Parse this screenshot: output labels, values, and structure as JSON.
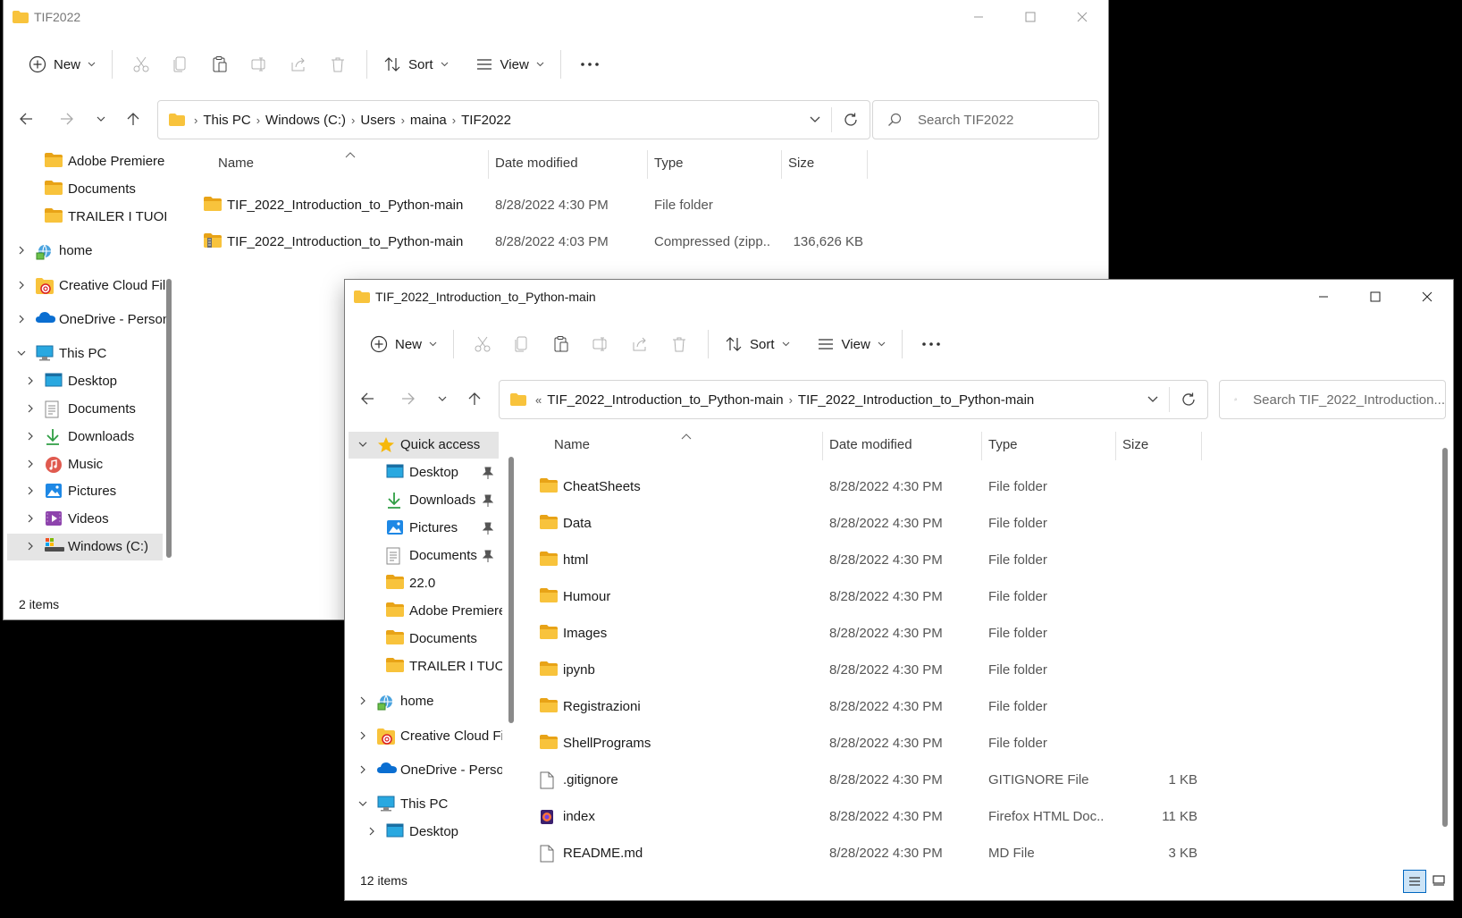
{
  "colors": {
    "folder": "#f8c33c",
    "folder_dark": "#e8a317",
    "accent": "#0067c0"
  },
  "back_window": {
    "title": "TIF2022",
    "toolbar": {
      "new_label": "New",
      "sort_label": "Sort",
      "view_label": "View"
    },
    "breadcrumb": [
      "This PC",
      "Windows (C:)",
      "Users",
      "maina",
      "TIF2022"
    ],
    "search_placeholder": "Search TIF2022",
    "sidebar": [
      {
        "label": "Adobe Premiere",
        "icon": "folder-icon"
      },
      {
        "label": "Documents",
        "icon": "folder-icon"
      },
      {
        "label": "TRAILER I TUOI (",
        "icon": "folder-icon"
      },
      {
        "label": "home",
        "icon": "home-network-icon"
      },
      {
        "label": "Creative Cloud File",
        "icon": "creative-cloud-icon"
      },
      {
        "label": "OneDrive - Person",
        "icon": "onedrive-icon"
      },
      {
        "label": "This PC",
        "icon": "pc-icon"
      },
      {
        "label": "Desktop",
        "icon": "desktop-icon"
      },
      {
        "label": "Documents",
        "icon": "documents-icon"
      },
      {
        "label": "Downloads",
        "icon": "downloads-icon"
      },
      {
        "label": "Music",
        "icon": "music-icon"
      },
      {
        "label": "Pictures",
        "icon": "pictures-icon"
      },
      {
        "label": "Videos",
        "icon": "videos-icon"
      },
      {
        "label": "Windows (C:)",
        "icon": "drive-icon"
      }
    ],
    "columns": [
      "Name",
      "Date modified",
      "Type",
      "Size"
    ],
    "files": [
      {
        "name": "TIF_2022_Introduction_to_Python-main",
        "date": "8/28/2022 4:30 PM",
        "type": "File folder",
        "size": "",
        "icon": "folder-icon"
      },
      {
        "name": "TIF_2022_Introduction_to_Python-main",
        "date": "8/28/2022 4:03 PM",
        "type": "Compressed (zipp...",
        "size": "136,626 KB",
        "icon": "zip-folder-icon"
      }
    ],
    "status": "2 items"
  },
  "front_window": {
    "title": "TIF_2022_Introduction_to_Python-main",
    "toolbar": {
      "new_label": "New",
      "sort_label": "Sort",
      "view_label": "View"
    },
    "breadcrumb_overflow": "«",
    "breadcrumb": [
      "TIF_2022_Introduction_to_Python-main",
      "TIF_2022_Introduction_to_Python-main"
    ],
    "search_placeholder": "Search TIF_2022_Introduction...",
    "sidebar": [
      {
        "label": "Quick access",
        "icon": "star-icon"
      },
      {
        "label": "Desktop",
        "icon": "desktop-icon"
      },
      {
        "label": "Downloads",
        "icon": "downloads-icon"
      },
      {
        "label": "Pictures",
        "icon": "pictures-icon"
      },
      {
        "label": "Documents",
        "icon": "documents-icon"
      },
      {
        "label": "22.0",
        "icon": "folder-icon"
      },
      {
        "label": "Adobe Premiere",
        "icon": "folder-icon"
      },
      {
        "label": "Documents",
        "icon": "folder-icon"
      },
      {
        "label": "TRAILER I TUOI (",
        "icon": "folder-icon"
      },
      {
        "label": "home",
        "icon": "home-network-icon"
      },
      {
        "label": "Creative Cloud File",
        "icon": "creative-cloud-icon"
      },
      {
        "label": "OneDrive - Person",
        "icon": "onedrive-icon"
      },
      {
        "label": "This PC",
        "icon": "pc-icon"
      },
      {
        "label": "Desktop",
        "icon": "desktop-icon"
      }
    ],
    "columns": [
      "Name",
      "Date modified",
      "Type",
      "Size"
    ],
    "files": [
      {
        "name": "CheatSheets",
        "date": "8/28/2022 4:30 PM",
        "type": "File folder",
        "size": "",
        "icon": "folder-icon"
      },
      {
        "name": "Data",
        "date": "8/28/2022 4:30 PM",
        "type": "File folder",
        "size": "",
        "icon": "folder-icon"
      },
      {
        "name": "html",
        "date": "8/28/2022 4:30 PM",
        "type": "File folder",
        "size": "",
        "icon": "folder-icon"
      },
      {
        "name": "Humour",
        "date": "8/28/2022 4:30 PM",
        "type": "File folder",
        "size": "",
        "icon": "folder-icon"
      },
      {
        "name": "Images",
        "date": "8/28/2022 4:30 PM",
        "type": "File folder",
        "size": "",
        "icon": "folder-icon"
      },
      {
        "name": "ipynb",
        "date": "8/28/2022 4:30 PM",
        "type": "File folder",
        "size": "",
        "icon": "folder-icon"
      },
      {
        "name": "Registrazioni",
        "date": "8/28/2022 4:30 PM",
        "type": "File folder",
        "size": "",
        "icon": "folder-icon"
      },
      {
        "name": "ShellPrograms",
        "date": "8/28/2022 4:30 PM",
        "type": "File folder",
        "size": "",
        "icon": "folder-icon"
      },
      {
        "name": ".gitignore",
        "date": "8/28/2022 4:30 PM",
        "type": "GITIGNORE File",
        "size": "1 KB",
        "icon": "file-icon"
      },
      {
        "name": "index",
        "date": "8/28/2022 4:30 PM",
        "type": "Firefox HTML Doc...",
        "size": "11 KB",
        "icon": "firefox-icon"
      },
      {
        "name": "README.md",
        "date": "8/28/2022 4:30 PM",
        "type": "MD File",
        "size": "3 KB",
        "icon": "file-icon"
      }
    ],
    "status": "12 items"
  }
}
